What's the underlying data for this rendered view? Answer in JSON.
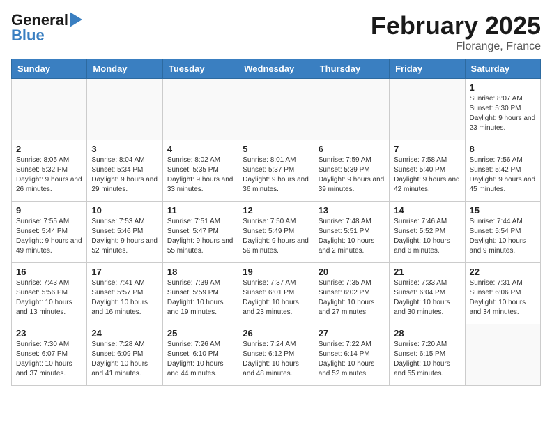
{
  "header": {
    "logo_general": "General",
    "logo_blue": "Blue",
    "month_title": "February 2025",
    "location": "Florange, France"
  },
  "days_of_week": [
    "Sunday",
    "Monday",
    "Tuesday",
    "Wednesday",
    "Thursday",
    "Friday",
    "Saturday"
  ],
  "weeks": [
    [
      {
        "day": "",
        "info": ""
      },
      {
        "day": "",
        "info": ""
      },
      {
        "day": "",
        "info": ""
      },
      {
        "day": "",
        "info": ""
      },
      {
        "day": "",
        "info": ""
      },
      {
        "day": "",
        "info": ""
      },
      {
        "day": "1",
        "info": "Sunrise: 8:07 AM\nSunset: 5:30 PM\nDaylight: 9 hours and 23 minutes."
      }
    ],
    [
      {
        "day": "2",
        "info": "Sunrise: 8:05 AM\nSunset: 5:32 PM\nDaylight: 9 hours and 26 minutes."
      },
      {
        "day": "3",
        "info": "Sunrise: 8:04 AM\nSunset: 5:34 PM\nDaylight: 9 hours and 29 minutes."
      },
      {
        "day": "4",
        "info": "Sunrise: 8:02 AM\nSunset: 5:35 PM\nDaylight: 9 hours and 33 minutes."
      },
      {
        "day": "5",
        "info": "Sunrise: 8:01 AM\nSunset: 5:37 PM\nDaylight: 9 hours and 36 minutes."
      },
      {
        "day": "6",
        "info": "Sunrise: 7:59 AM\nSunset: 5:39 PM\nDaylight: 9 hours and 39 minutes."
      },
      {
        "day": "7",
        "info": "Sunrise: 7:58 AM\nSunset: 5:40 PM\nDaylight: 9 hours and 42 minutes."
      },
      {
        "day": "8",
        "info": "Sunrise: 7:56 AM\nSunset: 5:42 PM\nDaylight: 9 hours and 45 minutes."
      }
    ],
    [
      {
        "day": "9",
        "info": "Sunrise: 7:55 AM\nSunset: 5:44 PM\nDaylight: 9 hours and 49 minutes."
      },
      {
        "day": "10",
        "info": "Sunrise: 7:53 AM\nSunset: 5:46 PM\nDaylight: 9 hours and 52 minutes."
      },
      {
        "day": "11",
        "info": "Sunrise: 7:51 AM\nSunset: 5:47 PM\nDaylight: 9 hours and 55 minutes."
      },
      {
        "day": "12",
        "info": "Sunrise: 7:50 AM\nSunset: 5:49 PM\nDaylight: 9 hours and 59 minutes."
      },
      {
        "day": "13",
        "info": "Sunrise: 7:48 AM\nSunset: 5:51 PM\nDaylight: 10 hours and 2 minutes."
      },
      {
        "day": "14",
        "info": "Sunrise: 7:46 AM\nSunset: 5:52 PM\nDaylight: 10 hours and 6 minutes."
      },
      {
        "day": "15",
        "info": "Sunrise: 7:44 AM\nSunset: 5:54 PM\nDaylight: 10 hours and 9 minutes."
      }
    ],
    [
      {
        "day": "16",
        "info": "Sunrise: 7:43 AM\nSunset: 5:56 PM\nDaylight: 10 hours and 13 minutes."
      },
      {
        "day": "17",
        "info": "Sunrise: 7:41 AM\nSunset: 5:57 PM\nDaylight: 10 hours and 16 minutes."
      },
      {
        "day": "18",
        "info": "Sunrise: 7:39 AM\nSunset: 5:59 PM\nDaylight: 10 hours and 19 minutes."
      },
      {
        "day": "19",
        "info": "Sunrise: 7:37 AM\nSunset: 6:01 PM\nDaylight: 10 hours and 23 minutes."
      },
      {
        "day": "20",
        "info": "Sunrise: 7:35 AM\nSunset: 6:02 PM\nDaylight: 10 hours and 27 minutes."
      },
      {
        "day": "21",
        "info": "Sunrise: 7:33 AM\nSunset: 6:04 PM\nDaylight: 10 hours and 30 minutes."
      },
      {
        "day": "22",
        "info": "Sunrise: 7:31 AM\nSunset: 6:06 PM\nDaylight: 10 hours and 34 minutes."
      }
    ],
    [
      {
        "day": "23",
        "info": "Sunrise: 7:30 AM\nSunset: 6:07 PM\nDaylight: 10 hours and 37 minutes."
      },
      {
        "day": "24",
        "info": "Sunrise: 7:28 AM\nSunset: 6:09 PM\nDaylight: 10 hours and 41 minutes."
      },
      {
        "day": "25",
        "info": "Sunrise: 7:26 AM\nSunset: 6:10 PM\nDaylight: 10 hours and 44 minutes."
      },
      {
        "day": "26",
        "info": "Sunrise: 7:24 AM\nSunset: 6:12 PM\nDaylight: 10 hours and 48 minutes."
      },
      {
        "day": "27",
        "info": "Sunrise: 7:22 AM\nSunset: 6:14 PM\nDaylight: 10 hours and 52 minutes."
      },
      {
        "day": "28",
        "info": "Sunrise: 7:20 AM\nSunset: 6:15 PM\nDaylight: 10 hours and 55 minutes."
      },
      {
        "day": "",
        "info": ""
      }
    ]
  ]
}
